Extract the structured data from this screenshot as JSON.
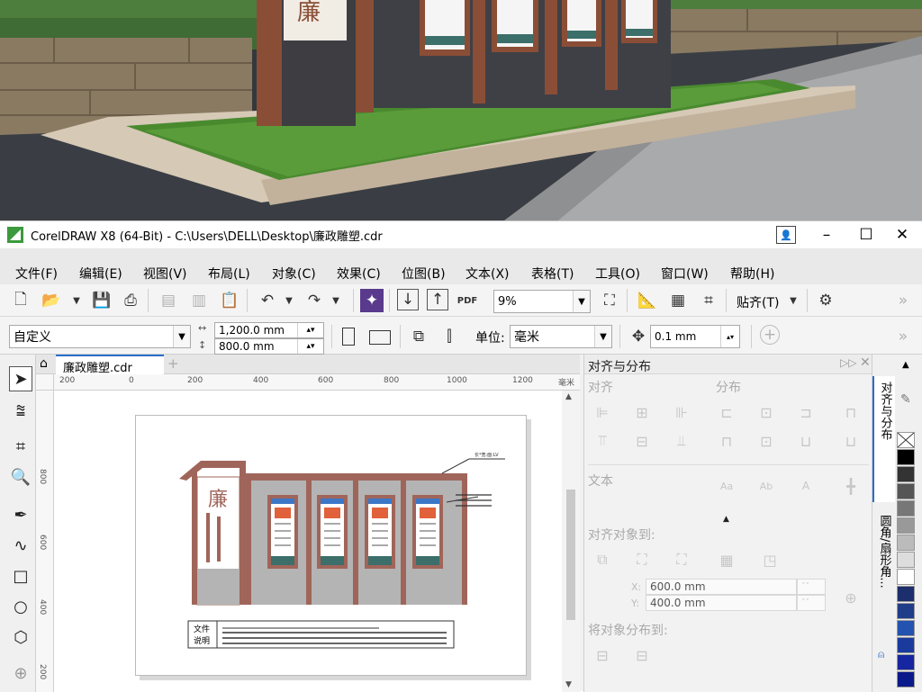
{
  "app": {
    "title": "CorelDRAW X8 (64-Bit) - C:\\Users\\DELL\\Desktop\\廉政雕塑.cdr",
    "minimize": "–",
    "maximize": "☐",
    "close": "✕"
  },
  "menu": [
    "文件(F)",
    "编辑(E)",
    "视图(V)",
    "布局(L)",
    "对象(C)",
    "效果(C)",
    "位图(B)",
    "文本(X)",
    "表格(T)",
    "工具(O)",
    "窗口(W)",
    "帮助(H)"
  ],
  "toolbar": {
    "zoom_value": "9%",
    "snap_label": "贴齐(T)",
    "pdf_label": "PDF"
  },
  "propbar": {
    "page_preset": "自定义",
    "width": "1,200.0 mm",
    "height": "800.0 mm",
    "unit_label": "单位:",
    "unit_value": "毫米",
    "nudge": "0.1 mm"
  },
  "document": {
    "tab_label": "廉政雕塑.cdr",
    "ruler_unit": "毫米",
    "ruler_h": [
      "200",
      "0",
      "200",
      "400",
      "600",
      "800",
      "1000",
      "1200"
    ],
    "ruler_v": [
      "800",
      "600",
      "400",
      "200"
    ],
    "callout_label": "长*宽:面:LV",
    "note_label_1": "文件",
    "note_label_2": "说明"
  },
  "docker": {
    "title": "对齐与分布",
    "align_label": "对齐",
    "distribute_label": "分布",
    "text_label": "文本",
    "align_to_label": "对齐对象到:",
    "x_label": "X:",
    "x_value": "600.0 mm",
    "y_label": "Y:",
    "y_value": "400.0 mm",
    "distribute_to_label": "将对象分布到:"
  },
  "side_tabs": [
    "对齐与分布",
    "圆角/扇形角..."
  ],
  "colors": {
    "brand_green": "#3c9a3c",
    "sculpture_brown": "#a0655a",
    "wall_grey": "#b4b4b4"
  }
}
